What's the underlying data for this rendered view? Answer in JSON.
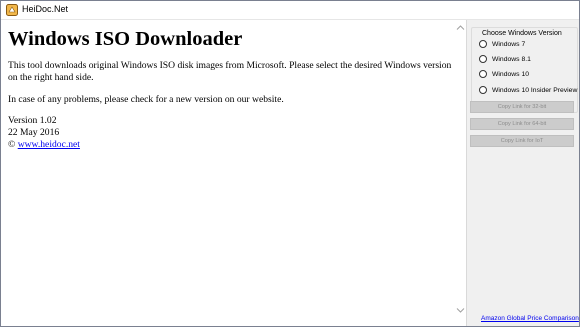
{
  "window": {
    "title": "HeiDoc.Net"
  },
  "main": {
    "heading": "Windows ISO Downloader",
    "paragraph1": "This tool downloads original Windows ISO disk images from Microsoft. Please select the desired Windows version on the right hand side.",
    "paragraph2": "In case of any problems, please check for a new version on our website.",
    "version": "Version 1.02",
    "date": "22 May 2016",
    "copyright_symbol": "©",
    "website_link": "www.heidoc.net"
  },
  "sidebar": {
    "group_title": "Choose Windows Version",
    "options": [
      {
        "label": "Windows 7",
        "selected": false
      },
      {
        "label": "Windows 8.1",
        "selected": false
      },
      {
        "label": "Windows 10",
        "selected": false
      },
      {
        "label": "Windows 10 Insider Preview",
        "selected": false
      }
    ],
    "buttons": [
      {
        "label": "Copy Link for 32-bit",
        "enabled": false
      },
      {
        "label": "Copy Link for 64-bit",
        "enabled": false
      },
      {
        "label": "Copy Link for IoT",
        "enabled": false
      }
    ],
    "footer_link": "Amazon Global Price Comparison"
  },
  "colors": {
    "link": "#0000ee",
    "disabled_button_bg": "#cccccc",
    "disabled_button_text": "#8d8d8d",
    "frame": "#7a8090"
  }
}
